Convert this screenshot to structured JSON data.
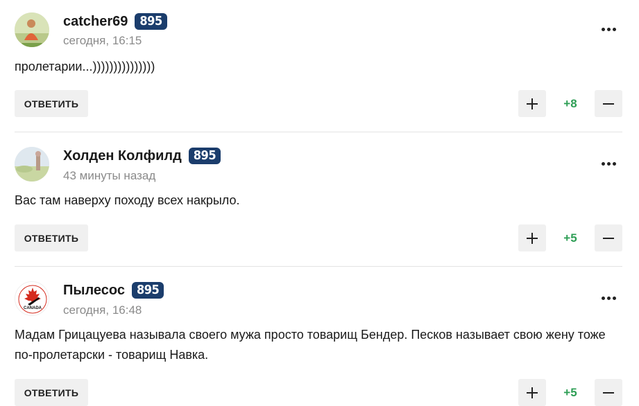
{
  "comments": [
    {
      "username": "catcher69",
      "badge": "895",
      "time": "сегодня, 16:15",
      "text": "пролетарии...)))))))))))))))",
      "reply_label": "ОТВЕТИТЬ",
      "score": "+8",
      "avatar_icon": "avatar-photo-person"
    },
    {
      "username": "Холден Колфилд",
      "badge": "895",
      "time": "43 минуты назад",
      "text": "Вас там наверху походу всех накрыло.",
      "reply_label": "ОТВЕТИТЬ",
      "score": "+5",
      "avatar_icon": "avatar-photo-landscape"
    },
    {
      "username": "Пылесос",
      "badge": "895",
      "time": "сегодня, 16:48",
      "text": "Мадам Грицацуева называла своего мужа просто товарищ Бендер. Песков называет свою жену тоже по-пролетарски - товарищ Навка.",
      "reply_label": "ОТВЕТИТЬ",
      "score": "+5",
      "avatar_icon": "avatar-hockey-canada-logo",
      "logo_text": "CANADA"
    }
  ],
  "colors": {
    "badge_bg": "#1b3d6c",
    "score_positive": "#2e9e55",
    "button_bg": "#f0f0f0",
    "time_gray": "#8a8a8a"
  }
}
